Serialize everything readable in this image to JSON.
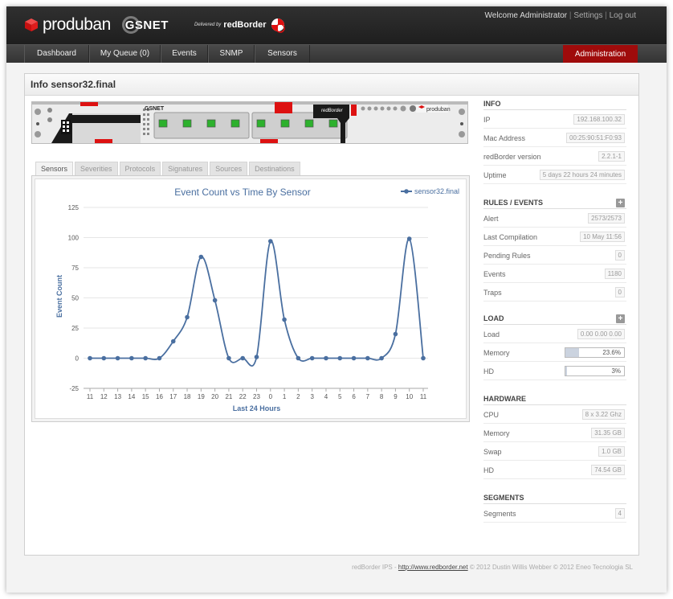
{
  "header": {
    "brand": "produban",
    "partner": "GSNET",
    "delivered_by": "Delivered by",
    "vendor": "redBorder",
    "welcome": "Welcome Administrator",
    "settings": "Settings",
    "logout": "Log out"
  },
  "nav": {
    "items": [
      "Dashboard",
      "My Queue (0)",
      "Events",
      "SNMP",
      "Sensors"
    ],
    "admin": "Administration"
  },
  "panel": {
    "title": "Info sensor32.final",
    "tabs": [
      "Sensors",
      "Severities",
      "Protocols",
      "Signatures",
      "Sources",
      "Destinations"
    ],
    "active_tab": "Sensors"
  },
  "device_labels": {
    "left": "GSNET",
    "right_badge": "redBorder",
    "right_brand": "produban"
  },
  "chart_data": {
    "type": "line",
    "title": "Event Count vs Time By Sensor",
    "xlabel": "Last 24 Hours",
    "ylabel": "Event Count",
    "ylim": [
      -25,
      125
    ],
    "yticks": [
      -25,
      0,
      25,
      50,
      75,
      100,
      125
    ],
    "legend_position": "top-right",
    "categories": [
      "11",
      "12",
      "13",
      "14",
      "15",
      "16",
      "17",
      "18",
      "19",
      "20",
      "21",
      "22",
      "23",
      "0",
      "1",
      "2",
      "3",
      "4",
      "5",
      "6",
      "7",
      "8",
      "9",
      "10",
      "11"
    ],
    "series": [
      {
        "name": "sensor32.final",
        "color": "#4a6fa0",
        "values": [
          0,
          0,
          0,
          0,
          0,
          0,
          14,
          34,
          84,
          48,
          0,
          0,
          1,
          97,
          32,
          0,
          0,
          0,
          0,
          0,
          0,
          0,
          20,
          99,
          0
        ]
      }
    ]
  },
  "sidebar": {
    "info": {
      "title": "INFO",
      "rows": [
        {
          "label": "IP",
          "value": "192.168.100.32"
        },
        {
          "label": "Mac Address",
          "value": "00:25:90:51:F0:93"
        },
        {
          "label": "redBorder version",
          "value": "2.2.1-1"
        },
        {
          "label": "Uptime",
          "value": "5 days 22 hours 24 minutes"
        }
      ]
    },
    "rules": {
      "title": "RULES / EVENTS",
      "rows": [
        {
          "label": "Alert",
          "value": "2573/2573"
        },
        {
          "label": "Last Compilation",
          "value": "10 May 11:56"
        },
        {
          "label": "Pending Rules",
          "value": "0"
        },
        {
          "label": "Events",
          "value": "1180"
        },
        {
          "label": "Traps",
          "value": "0"
        }
      ]
    },
    "load": {
      "title": "LOAD",
      "load_label": "Load",
      "load_value": "0.00 0.00 0.00",
      "memory_label": "Memory",
      "memory_value": "23.6%",
      "memory_fraction": 0.236,
      "hd_label": "HD",
      "hd_value": "3%",
      "hd_fraction": 0.03
    },
    "hardware": {
      "title": "HARDWARE",
      "rows": [
        {
          "label": "CPU",
          "value": "8 x 3.22 Ghz"
        },
        {
          "label": "Memory",
          "value": "31.35 GB"
        },
        {
          "label": "Swap",
          "value": "1.0 GB"
        },
        {
          "label": "HD",
          "value": "74.54 GB"
        }
      ]
    },
    "segments": {
      "title": "SEGMENTS",
      "rows": [
        {
          "label": "Segments",
          "value": "4"
        }
      ]
    }
  },
  "footer": {
    "prefix": "redBorder IPS - ",
    "link": "http://www.redborder.net",
    "suffix": " © 2012 Dustin Willis Webber © 2012 Eneo Tecnologia SL"
  }
}
